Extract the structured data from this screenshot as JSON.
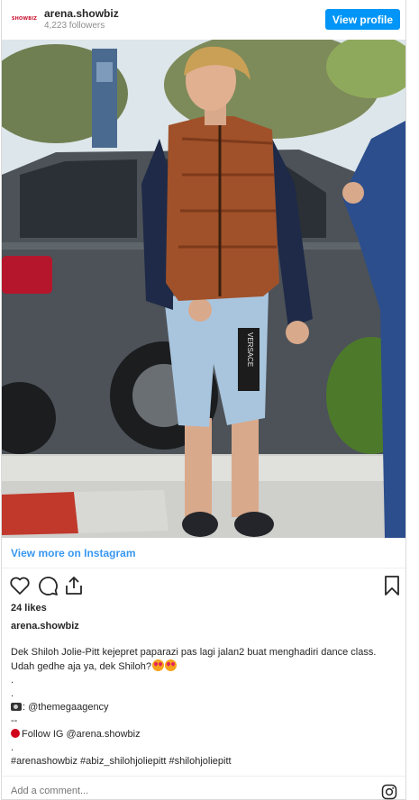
{
  "header": {
    "avatar_text": "SHOWBIZ",
    "username": "arena.showbiz",
    "followers": "4,223 followers",
    "view_profile_label": "View profile"
  },
  "photo": {
    "jacket_text": "VERSACE"
  },
  "view_more_label": "View more on Instagram",
  "actions": {
    "icons": [
      "heart-icon",
      "comment-icon",
      "share-icon",
      "bookmark-icon"
    ]
  },
  "likes": "24 likes",
  "caption": {
    "username": "arena.showbiz",
    "line1": "Dek Shiloh Jolie-Pitt kejepret paparazi pas lagi jalan2 buat menghadiri dance class.",
    "line2": "Udah gedhe aja ya, dek Shiloh?",
    "dot1": ".",
    "dot2": ".",
    "credit": ": @themegaagency",
    "dashes": "--",
    "follow": "Follow IG @arena.showbiz",
    "dot3": ".",
    "hashtags": "#arenashowbiz #abiz_shilohjoliepitt #shilohjoliepitt"
  },
  "comment": {
    "placeholder": "Add a comment..."
  },
  "colors": {
    "accent": "#0095f6",
    "link": "#3897f0",
    "text": "#262626",
    "muted": "#8e8e8e"
  }
}
